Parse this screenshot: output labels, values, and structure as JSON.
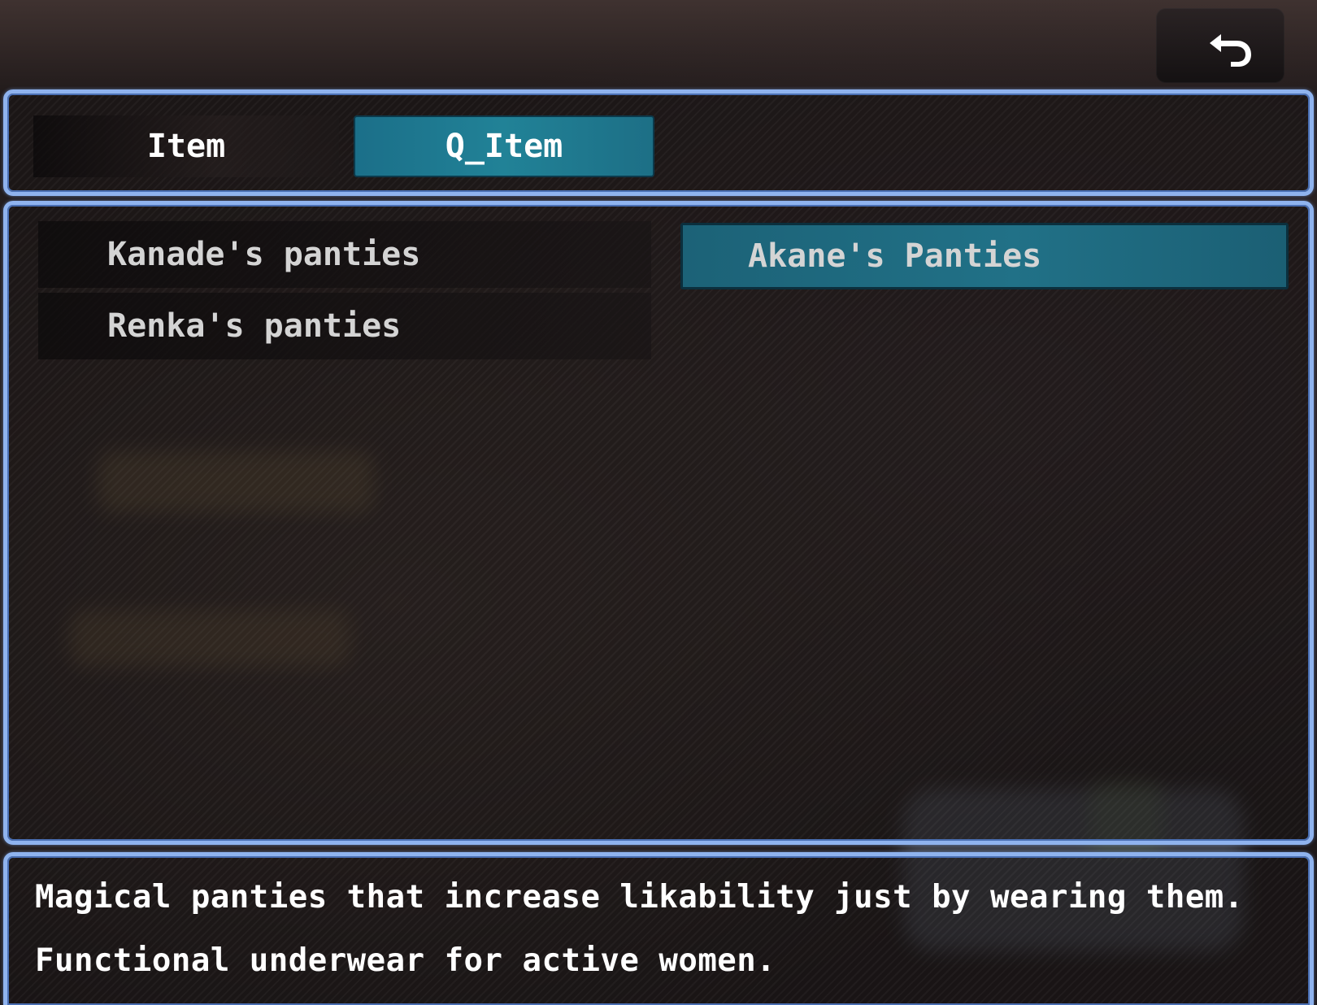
{
  "header": {
    "back_button_icon": "return-arrow-icon"
  },
  "tabs": [
    {
      "label": "Item",
      "selected": false
    },
    {
      "label": "Q_Item",
      "selected": true
    }
  ],
  "items": [
    {
      "label": "Kanade's panties",
      "selected": false
    },
    {
      "label": "Akane's Panties",
      "selected": true
    },
    {
      "label": "Renka's panties",
      "selected": false
    }
  ],
  "help": {
    "line1": "Magical panties that increase likability just by wearing them.",
    "line2": "Functional underwear for active women."
  },
  "colors": {
    "window_border": "#8fb3ee",
    "selected_highlight": "#217187",
    "text": "#ffffff"
  }
}
